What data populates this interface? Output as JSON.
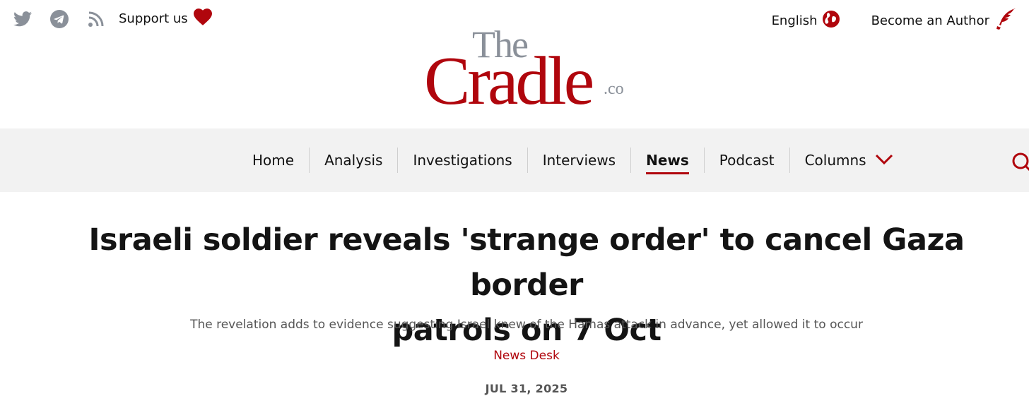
{
  "topbar": {
    "icons": [
      "twitter-icon",
      "telegram-icon",
      "rss-icon"
    ],
    "support_label": "Support us",
    "language_label": "English",
    "author_label": "Become an Author"
  },
  "logo": {
    "the": "The",
    "cradle": "Cradle",
    "co": ".co"
  },
  "nav": {
    "items": [
      {
        "label": "Home"
      },
      {
        "label": "Analysis"
      },
      {
        "label": "Investigations"
      },
      {
        "label": "Interviews"
      },
      {
        "label": "News",
        "active": true
      },
      {
        "label": "Podcast"
      },
      {
        "label": "Columns"
      }
    ]
  },
  "article": {
    "headline_line1": "Israeli soldier reveals 'strange order' to cancel Gaza border",
    "headline_line2": "patrols on 7 Oct",
    "subtitle": "The revelation adds to evidence suggesting Israel knew of the Hamas attack in advance, yet allowed it to occur",
    "byline": "News Desk",
    "date": "JUL 31, 2025"
  },
  "colors": {
    "brand_red": "#b0060d",
    "icon_gray": "#8a9099",
    "nav_bg": "#f2f2f2"
  }
}
